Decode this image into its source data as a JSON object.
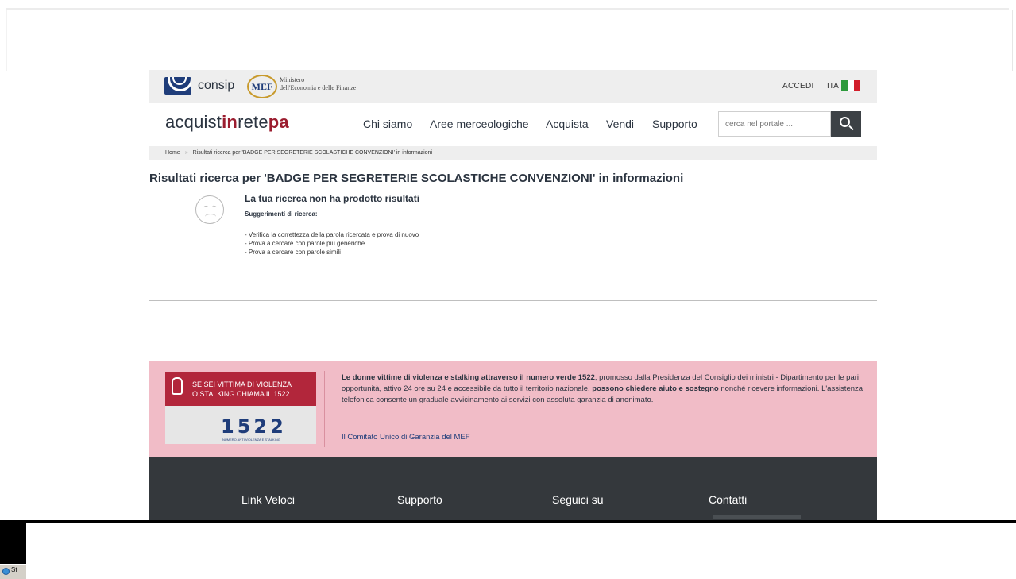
{
  "institutional": {
    "consip": "consip",
    "mef": "MEF",
    "mef_subtitle_1": "Ministero",
    "mef_subtitle_2": "dell'Economia e delle Finanze",
    "accedi": "ACCEDI",
    "lang": "ITA"
  },
  "nav": {
    "brand_a": "acquist",
    "brand_in": "in",
    "brand_rete": "rete",
    "brand_pa": "pa",
    "items": [
      "Chi siamo",
      "Aree merceologiche",
      "Acquista",
      "Vendi",
      "Supporto"
    ],
    "search_placeholder": "cerca nel portale ..."
  },
  "breadcrumb": {
    "home": "Home",
    "sep": "»",
    "current": "Risultati ricerca per 'BADGE PER SEGRETERIE SCOLASTICHE CONVENZIONI' in informazioni"
  },
  "results": {
    "title": "Risultati ricerca per 'BADGE PER SEGRETERIE SCOLASTICHE CONVENZIONI' in informazioni",
    "no_results": "La tua ricerca non ha prodotto risultati",
    "suggestions_title": "Suggerimenti di ricerca:",
    "suggestions": [
      "- Verifica la correttezza della parola ricercata e prova di nuovo",
      "- Prova a cercare con parole più generiche",
      "- Prova a cercare con parole simili"
    ]
  },
  "banner": {
    "badge_line1": "SE SEI VITTIMA DI VIOLENZA",
    "badge_line2": "O STALKING CHIAMA IL 1522",
    "badge_number": "1522",
    "badge_small": "NUMERO ANTI VIOLENZA E STALKING",
    "text_bold1": "Le donne vittime di violenza e stalking attraverso il numero verde 1522",
    "text_1": ", promosso dalla Presidenza del Consiglio dei ministri - Dipartimento per le pari opportunità, attivo 24 ore su 24 e accessibile da tutto il territorio nazionale, ",
    "text_bold2": "possono chiedere aiuto e sostegno",
    "text_2": " nonché ricevere informazioni. L'assistenza telefonica consente un graduale avvicinamento ai servizi con assoluta garanzia di anonimato.",
    "link": "Il Comitato Unico di Garanzia del MEF"
  },
  "footer": {
    "headings": [
      "Link Veloci",
      "Supporto",
      "Seguici su",
      "Contatti"
    ]
  },
  "taskbar": {
    "button": "St"
  },
  "colors": {
    "brand_red": "#9b1d2f",
    "footer_bg": "#34383c",
    "banner_bg": "#f1bcc7",
    "bar_bg": "#eeeeee"
  }
}
